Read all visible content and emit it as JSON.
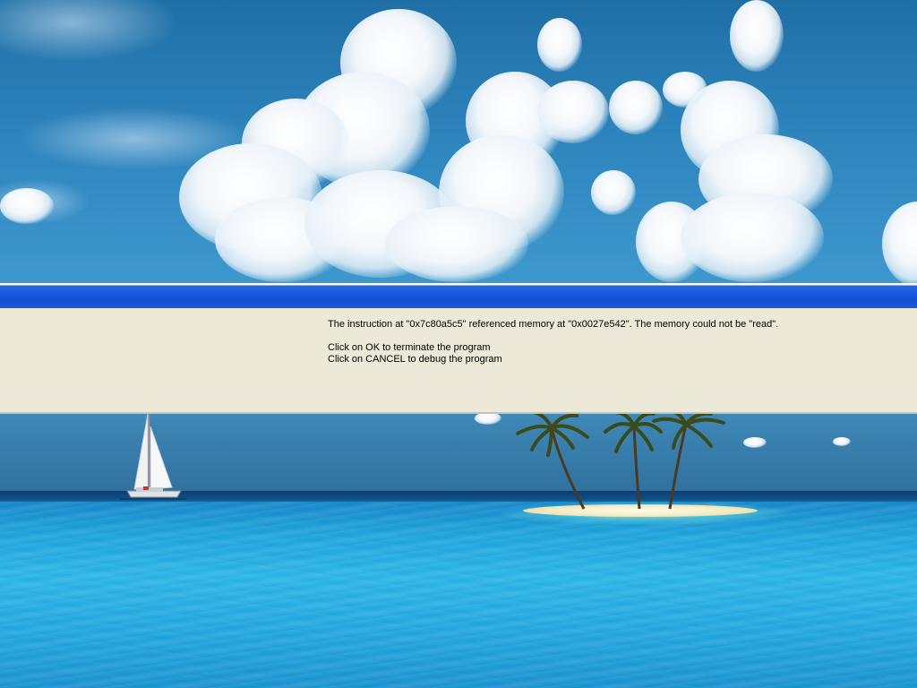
{
  "dialog": {
    "message_line1": "The instruction at \"0x7c80a5c5\" referenced memory at \"0x0027e542\". The memory could not be \"read\".",
    "message_line2": "Click on OK to terminate the program",
    "message_line3": "Click on CANCEL to debug the program"
  },
  "colors": {
    "title_bar": "#1450d4",
    "dialog_body": "#ece9d8",
    "sky": "#2f86bf",
    "sea": "#2cb8e8"
  },
  "wallpaper": {
    "elements": [
      "clouds",
      "sailboat",
      "palm-trees",
      "island",
      "ocean"
    ]
  }
}
